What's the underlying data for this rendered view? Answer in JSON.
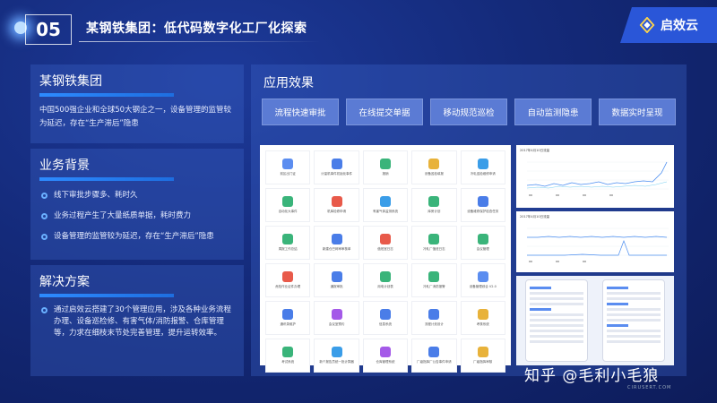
{
  "header": {
    "number": "05",
    "title": "某钢铁集团：低代码数字化工厂化探索",
    "logo_text": "启效云",
    "logo_color": "#2a56d8"
  },
  "company_panel": {
    "title": "某钢铁集团",
    "text": "中国500强企业和全球50大钢企之一，设备管理的监管较为延迟，存在“生产滞后”隐患"
  },
  "background_panel": {
    "title": "业务背景",
    "items": [
      "线下审批步骤多、耗时久",
      "业务过程产生了大量纸质单据，耗时费力",
      "设备管理的监管较为延迟，存在“生产滞后”隐患"
    ]
  },
  "solution_panel": {
    "title": "解决方案",
    "text": "通过启效云搭建了30个管理应用，涉及各种业务流程办理、设备巡检修、有害气体/消防报警、仓库管理等，力求在细枝末节处完善管理，提升运转效率。"
  },
  "effects": {
    "title": "应用效果",
    "tabs": [
      "流程快速审批",
      "在线提交单据",
      "移动规范巡检",
      "自动监测隐患",
      "数据实时呈现"
    ]
  },
  "app_grid": [
    {
      "label": "前区出门证",
      "color": "#5b8df0"
    },
    {
      "label": "计量机事件初始化事件",
      "color": "#4a7de8"
    },
    {
      "label": "报销",
      "color": "#3ab47a"
    },
    {
      "label": "设备巡检填报",
      "color": "#e8b23a"
    },
    {
      "label": "冷轧巡检维修申请",
      "color": "#3a9de8"
    },
    {
      "label": "自动化大事件",
      "color": "#3ab47a"
    },
    {
      "label": "机库检修申请",
      "color": "#e85a4a"
    },
    {
      "label": "有害气体监测系统",
      "color": "#3a9de8"
    },
    {
      "label": "库房计划",
      "color": "#3ab47a"
    },
    {
      "label": "设备维修保护检查任务",
      "color": "#4a7de8"
    },
    {
      "label": "周报工作总结",
      "color": "#3ab47a"
    },
    {
      "label": "新建仓巴网审审核单",
      "color": "#4a7de8"
    },
    {
      "label": "值班室日志",
      "color": "#e85a4a"
    },
    {
      "label": "冷轧厂值班日志",
      "color": "#3ab47a"
    },
    {
      "label": "会议管理",
      "color": "#3ab47a"
    },
    {
      "label": "危险作业证件办理",
      "color": "#e85a4a"
    },
    {
      "label": "通报审批",
      "color": "#4a7de8"
    },
    {
      "label": "用电计划表",
      "color": "#3ab47a"
    },
    {
      "label": "冷轧厂消防报警",
      "color": "#3ab47a"
    },
    {
      "label": "设备管理综合 V2.0",
      "color": "#5b8df0"
    },
    {
      "label": "通讯录维护",
      "color": "#4a7de8"
    },
    {
      "label": "会议室预约",
      "color": "#a45ae8"
    },
    {
      "label": "信息系统",
      "color": "#4a7de8"
    },
    {
      "label": "流程计划设计",
      "color": "#4a7de8"
    },
    {
      "label": "考核系统",
      "color": "#e8b23a"
    },
    {
      "label": "考试系统",
      "color": "#3ab47a"
    },
    {
      "label": "新个报告员统一批计算器",
      "color": "#3a9de8"
    },
    {
      "label": "仓库管理系统",
      "color": "#a45ae8"
    },
    {
      "label": "厂级指挥厂公告事件申请",
      "color": "#4a7de8"
    },
    {
      "label": "厂级指挥审核",
      "color": "#e8b23a"
    }
  ],
  "charts": {
    "chart1_title": "2017年4月10日流量",
    "chart2_title": "2017年4月10日流量"
  },
  "watermark": {
    "text": "知乎 @毛利小毛狼",
    "sub": "CIRUSERT.COM"
  }
}
